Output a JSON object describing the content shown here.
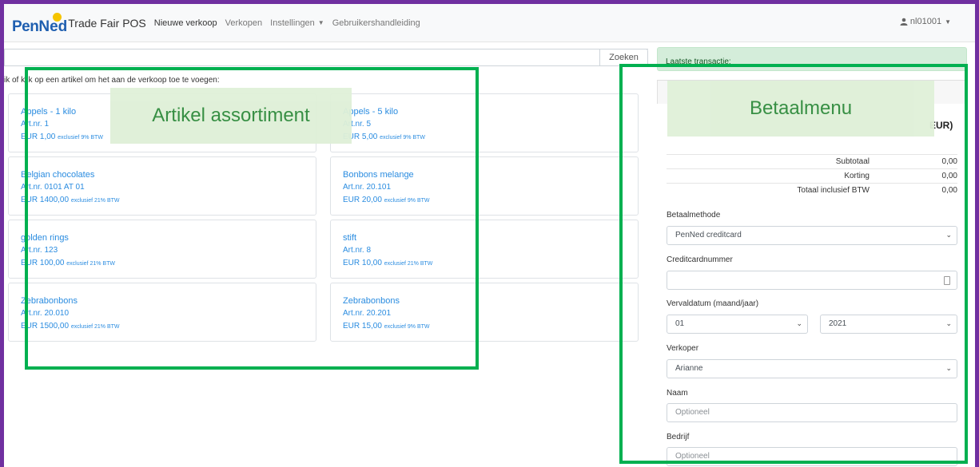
{
  "navbar": {
    "logo_text_pen": "Pen",
    "logo_text_ned": "Ned",
    "brand": "Trade Fair POS",
    "links": [
      "Nieuwe verkoop",
      "Verkopen",
      "Instellingen",
      "Gebruikershandleiding"
    ],
    "user": "nl01001"
  },
  "search": {
    "placeholder": "",
    "button": "Zoeken"
  },
  "instruction": "ik of klik op een artikel om het aan de verkoop toe te voegen:",
  "products": [
    {
      "name": "Appels - 1 kilo",
      "artnr": "Art.nr. 1",
      "price": "EUR 1,00",
      "vat": "exclusief 9% BTW"
    },
    {
      "name": "Appels - 5 kilo",
      "artnr": "Art.nr. 5",
      "price": "EUR 5,00",
      "vat": "exclusief 9% BTW"
    },
    {
      "name": "Belgian chocolates",
      "artnr": "Art.nr. 0101 AT 01",
      "price": "EUR 1400,00",
      "vat": "exclusief 21% BTW"
    },
    {
      "name": "Bonbons melange",
      "artnr": "Art.nr. 20.101",
      "price": "EUR 20,00",
      "vat": "exclusief 9% BTW"
    },
    {
      "name": "golden rings",
      "artnr": "Art.nr. 123",
      "price": "EUR 100,00",
      "vat": "exclusief 21% BTW"
    },
    {
      "name": "stift",
      "artnr": "Art.nr. 8",
      "price": "EUR 10,00",
      "vat": "exclusief 21% BTW"
    },
    {
      "name": "Zebrabonbons",
      "artnr": "Art.nr. 20.010",
      "price": "EUR 1500,00",
      "vat": "exclusief 21% BTW"
    },
    {
      "name": "Zebrabonbons",
      "artnr": "Art.nr. 20.201",
      "price": "EUR 15,00",
      "vat": "exclusief 9% BTW"
    }
  ],
  "annotations": {
    "left": "Artikel assortiment",
    "right": "Betaalmenu"
  },
  "payment": {
    "last_transaction": "Laatste transactie:",
    "currency_header": "EUR)",
    "totals": [
      {
        "label": "Subtotaal",
        "value": "0,00"
      },
      {
        "label": "Korting",
        "value": "0,00"
      },
      {
        "label": "Totaal inclusief BTW",
        "value": "0,00"
      }
    ],
    "method_label": "Betaalmethode",
    "method_value": "PenNed creditcard",
    "cc_label": "Creditcardnummer",
    "cc_value": "",
    "expiry_label": "Vervaldatum (maand/jaar)",
    "expiry_month": "01",
    "expiry_year": "2021",
    "seller_label": "Verkoper",
    "seller_value": "Arianne",
    "name_label": "Naam",
    "name_placeholder": "Optioneel",
    "company_label": "Bedrijf",
    "company_placeholder": "Optioneel"
  },
  "colors": {
    "frame": "#7030a0",
    "highlight_border": "#00b050",
    "link": "#2a8ce0",
    "label_bg": "#dff0d8"
  }
}
